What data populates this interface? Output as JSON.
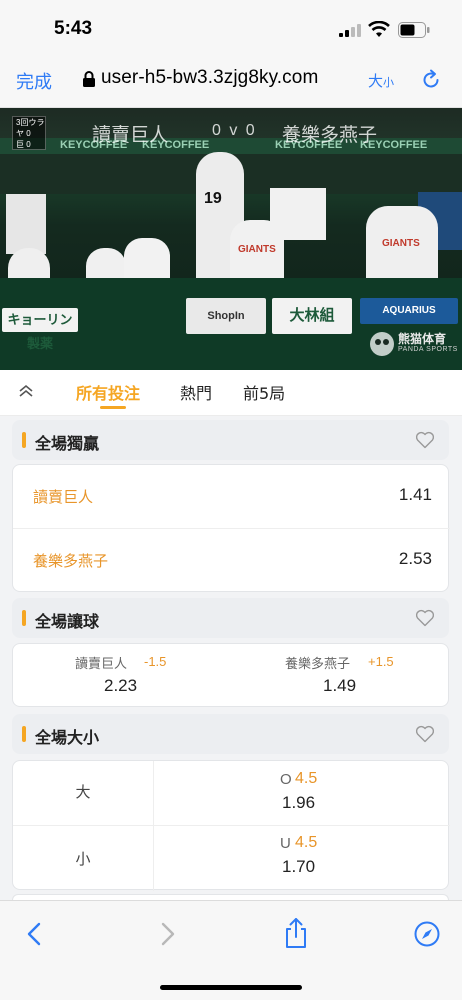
{
  "status": {
    "time": "5:43"
  },
  "browser": {
    "done_label": "完成",
    "url": "user-h5-bw3.3zjg8ky.com",
    "text_size_big": "大",
    "text_size_small": "小"
  },
  "video": {
    "home_team": "讀賣巨人",
    "score": "0 v 0",
    "away_team": "養樂多燕子",
    "scorebox_lines": [
      "3回ウラ",
      "ヤ 0",
      "巨 0"
    ],
    "banner_text": "KEYCOFFEE",
    "ad_1": "キョーリン製薬",
    "ad_2": "ShopIn",
    "ad_3": "大林組",
    "ad_4": "AQUARIUS",
    "jersey_number": "19",
    "jersey_text": "GIANTS",
    "watermark_cn": "熊猫体育",
    "watermark_en": "PANDA SPORTS"
  },
  "tabs": [
    {
      "label": "所有投注",
      "active": true
    },
    {
      "label": "熱門",
      "active": false
    },
    {
      "label": "前5局",
      "active": false
    }
  ],
  "moneyline": {
    "title": "全場獨贏",
    "rows": [
      {
        "name": "讀賣巨人",
        "odds": "1.41"
      },
      {
        "name": "養樂多燕子",
        "odds": "2.53"
      }
    ]
  },
  "handicap": {
    "title": "全場讓球",
    "home": {
      "name": "讀賣巨人",
      "line": "-1.5",
      "odds": "2.23"
    },
    "away": {
      "name": "養樂多燕子",
      "line": "+1.5",
      "odds": "1.49"
    }
  },
  "totals": {
    "title": "全場大小",
    "rows": [
      {
        "side": "大",
        "prefix": "O",
        "line": "4.5",
        "odds": "1.96"
      },
      {
        "side": "小",
        "prefix": "U",
        "line": "4.5",
        "odds": "1.70"
      }
    ]
  },
  "colors": {
    "accent": "#f5a623",
    "odds_name": "#e8952a",
    "ios_blue": "#2f7bf5"
  }
}
